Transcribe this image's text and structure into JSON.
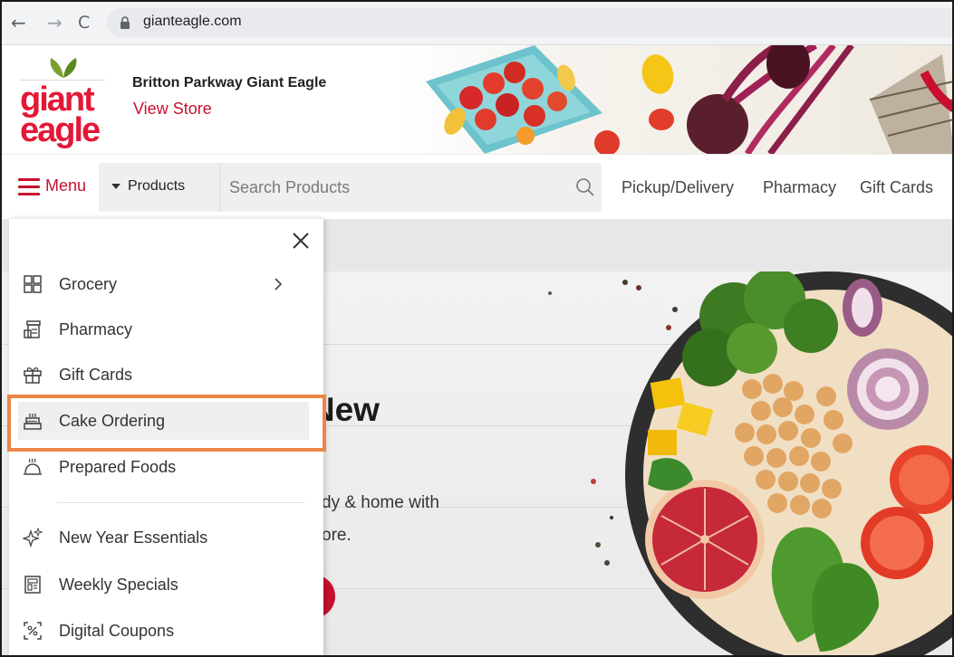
{
  "browser": {
    "back_glyph": "←",
    "forward_glyph": "→",
    "reload_glyph": "C",
    "url": "gianteagle.com"
  },
  "header": {
    "logo_line1": "giant",
    "logo_line2": "eagle",
    "store_name": "Britton Parkway Giant Eagle",
    "view_store": "View Store"
  },
  "nav": {
    "menu_label": "Menu",
    "products_label": "Products",
    "search_placeholder": "Search Products",
    "links": [
      "Pickup/Delivery",
      "Pharmacy",
      "Gift Cards"
    ]
  },
  "hero": {
    "title_visible": "e New",
    "line1_visible": "dy & home with",
    "line2_visible": "ore."
  },
  "side_menu": {
    "items": [
      {
        "label": "Grocery",
        "icon": "grid-icon",
        "has_submenu": true
      },
      {
        "label": "Pharmacy",
        "icon": "pharmacy-icon",
        "has_submenu": false
      },
      {
        "label": "Gift Cards",
        "icon": "gift-icon",
        "has_submenu": false
      },
      {
        "label": "Cake Ordering",
        "icon": "cake-icon",
        "has_submenu": false,
        "active": true
      },
      {
        "label": "Prepared Foods",
        "icon": "cloche-icon",
        "has_submenu": false
      },
      {
        "label": "New Year Essentials",
        "icon": "sparkle-icon",
        "has_submenu": false
      },
      {
        "label": "Weekly Specials",
        "icon": "newspaper-icon",
        "has_submenu": false
      },
      {
        "label": "Digital Coupons",
        "icon": "coupon-icon",
        "has_submenu": false
      }
    ]
  },
  "colors": {
    "brand_red": "#c8102e",
    "highlight_orange": "#ea8646",
    "active_item_bg": "#efefef"
  }
}
